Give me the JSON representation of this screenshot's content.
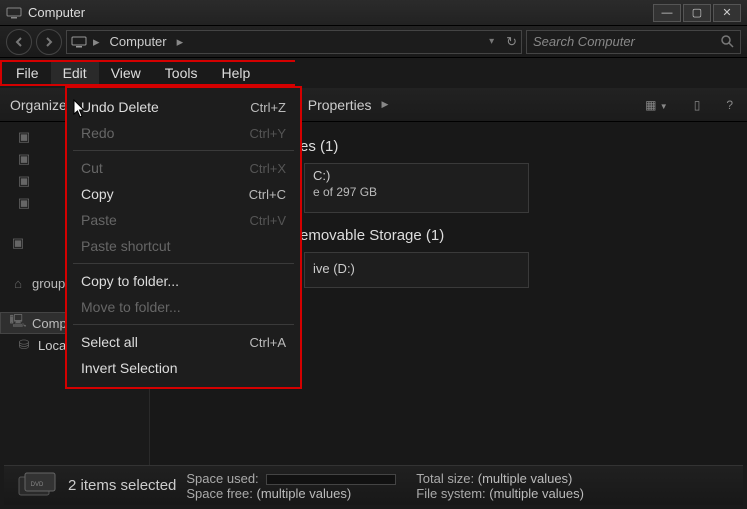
{
  "window": {
    "title": "Computer"
  },
  "address": {
    "root_icon": "computer",
    "crumb1": "Computer"
  },
  "search": {
    "placeholder": "Search Computer"
  },
  "menubar": {
    "file": "File",
    "edit": "Edit",
    "view": "View",
    "tools": "Tools",
    "help": "Help"
  },
  "toolbar": {
    "organize": "Organize",
    "properties": "Properties"
  },
  "sidebar": {
    "homegroup_partial": "group",
    "computer": "Computer",
    "local_disk": "Local Disk (C"
  },
  "main": {
    "hdd_header_partial": "es (1)",
    "drive_c_partial": "C:)",
    "drive_c_free_partial": "e of 297 GB",
    "removable_header_partial": "emovable Storage (1)",
    "drive_d_partial": "ive (D:)"
  },
  "edit_menu": {
    "undo": {
      "label": "Undo Delete",
      "shortcut": "Ctrl+Z",
      "enabled": true
    },
    "redo": {
      "label": "Redo",
      "shortcut": "Ctrl+Y",
      "enabled": false
    },
    "cut": {
      "label": "Cut",
      "shortcut": "Ctrl+X",
      "enabled": false
    },
    "copy": {
      "label": "Copy",
      "shortcut": "Ctrl+C",
      "enabled": true
    },
    "paste": {
      "label": "Paste",
      "shortcut": "Ctrl+V",
      "enabled": false
    },
    "paste_shortcut": {
      "label": "Paste shortcut",
      "shortcut": "",
      "enabled": false
    },
    "copy_to": {
      "label": "Copy to folder...",
      "shortcut": "",
      "enabled": true
    },
    "move_to": {
      "label": "Move to folder...",
      "shortcut": "",
      "enabled": false
    },
    "select_all": {
      "label": "Select all",
      "shortcut": "Ctrl+A",
      "enabled": true
    },
    "invert": {
      "label": "Invert Selection",
      "shortcut": "",
      "enabled": true
    }
  },
  "status": {
    "selection": "2 items selected",
    "space_used_label": "Space used:",
    "space_free_label": "Space free:",
    "space_free_value": "(multiple values)",
    "total_size_label": "Total size:",
    "total_size_value": "(multiple values)",
    "file_system_label": "File system:",
    "file_system_value": "(multiple values)"
  }
}
